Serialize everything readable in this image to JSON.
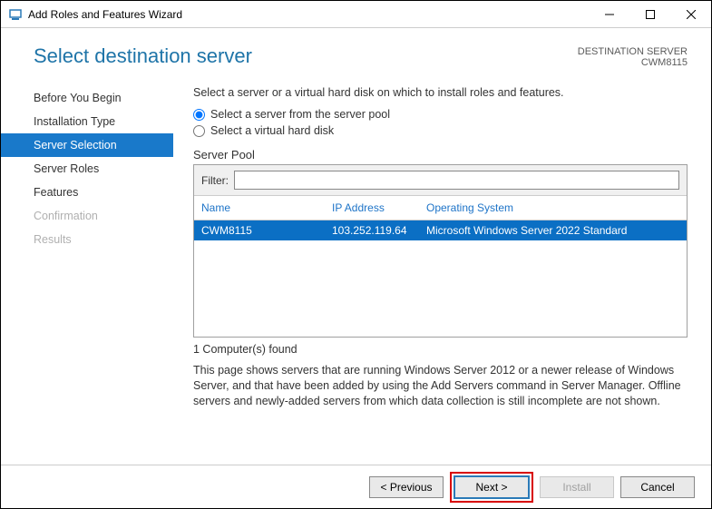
{
  "window": {
    "title": "Add Roles and Features Wizard"
  },
  "header": {
    "heading": "Select destination server",
    "dest_label": "DESTINATION SERVER",
    "dest_value": "CWM8115"
  },
  "nav": {
    "items": [
      {
        "label": "Before You Begin",
        "state": "normal"
      },
      {
        "label": "Installation Type",
        "state": "normal"
      },
      {
        "label": "Server Selection",
        "state": "selected"
      },
      {
        "label": "Server Roles",
        "state": "normal"
      },
      {
        "label": "Features",
        "state": "normal"
      },
      {
        "label": "Confirmation",
        "state": "disabled"
      },
      {
        "label": "Results",
        "state": "disabled"
      }
    ]
  },
  "main": {
    "instruction": "Select a server or a virtual hard disk on which to install roles and features.",
    "radio1": "Select a server from the server pool",
    "radio2": "Select a virtual hard disk",
    "pool_label": "Server Pool",
    "filter_label": "Filter:",
    "filter_value": "",
    "columns": {
      "name": "Name",
      "ip": "IP Address",
      "os": "Operating System"
    },
    "rows": [
      {
        "name": "CWM8115",
        "ip": "103.252.119.64",
        "os": "Microsoft Windows Server 2022 Standard",
        "selected": true
      }
    ],
    "found": "1 Computer(s) found",
    "note": "This page shows servers that are running Windows Server 2012 or a newer release of Windows Server, and that have been added by using the Add Servers command in Server Manager. Offline servers and newly-added servers from which data collection is still incomplete are not shown."
  },
  "footer": {
    "previous": "< Previous",
    "next": "Next >",
    "install": "Install",
    "cancel": "Cancel"
  }
}
